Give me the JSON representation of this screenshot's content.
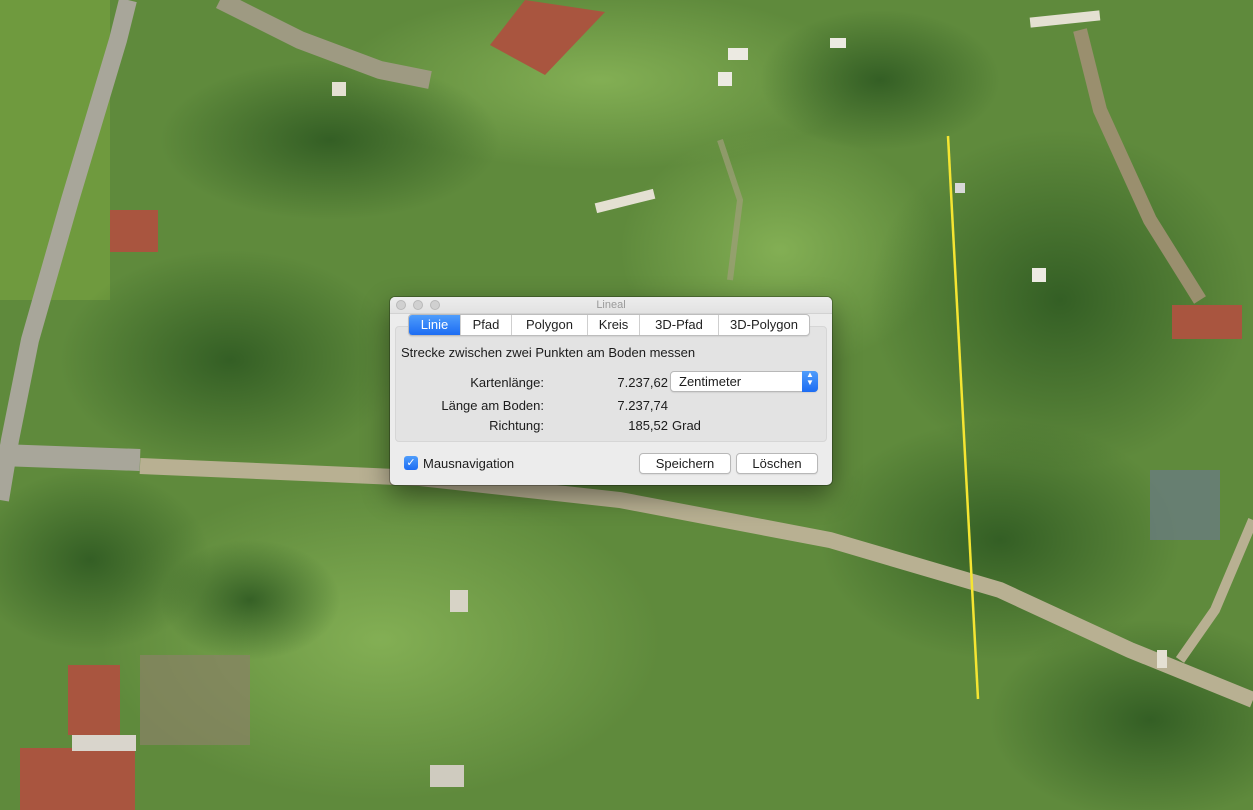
{
  "window": {
    "title": "Lineal",
    "tabs": [
      {
        "label": "Linie",
        "active": true
      },
      {
        "label": "Pfad",
        "active": false
      },
      {
        "label": "Polygon",
        "active": false
      },
      {
        "label": "Kreis",
        "active": false
      },
      {
        "label": "3D-Pfad",
        "active": false
      },
      {
        "label": "3D-Polygon",
        "active": false
      }
    ],
    "description": "Strecke zwischen zwei Punkten am Boden messen",
    "map_length": {
      "label": "Kartenlänge:",
      "value": "7.237,62",
      "unit": "Zentimeter"
    },
    "ground_length": {
      "label": "Länge am Boden:",
      "value": "7.237,74"
    },
    "heading": {
      "label": "Richtung:",
      "value": "185,52",
      "unit": "Grad"
    },
    "mouse_navigation": {
      "label": "Mausnavigation",
      "checked": true
    },
    "buttons": {
      "save": "Speichern",
      "clear": "Löschen"
    }
  },
  "colors": {
    "accent": "#1c6cf3",
    "measure_line": "#f5e532",
    "grass": "#5f8a3c",
    "roof": "#a9553f"
  },
  "icons": {
    "close": "close-icon",
    "minimize": "minimize-icon",
    "zoom": "zoom-icon",
    "checkbox": "checkmark-icon",
    "select": "select-arrows-icon"
  }
}
